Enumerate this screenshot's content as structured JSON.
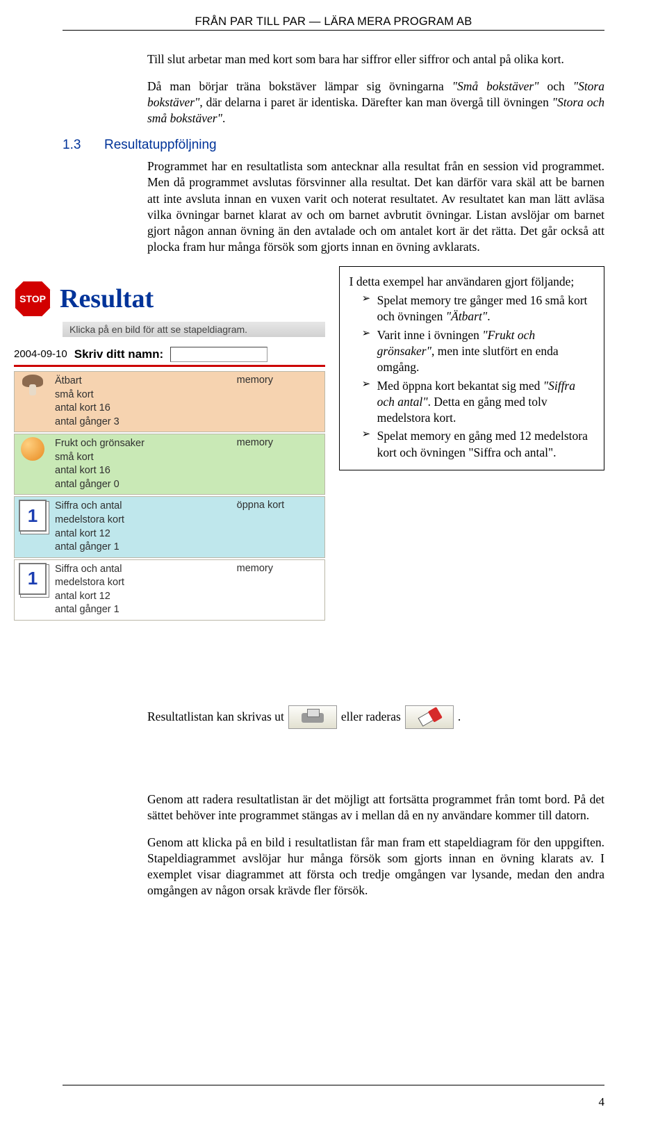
{
  "header": "FRÅN PAR TILL PAR — LÄRA MERA PROGRAM AB",
  "intro1": "Till slut arbetar man med kort som bara har siffror eller siffror och antal på olika kort.",
  "intro2_a": "Då man börjar träna bokstäver lämpar sig övningarna ",
  "intro2_i1": "\"Små bokstäver\"",
  "intro2_b": " och ",
  "intro2_i2": "\"Stora bokstäver\"",
  "intro2_c": ", där delarna i paret är identiska. Därefter kan man övergå till övningen ",
  "intro2_i3": "\"Stora och små bokstäver\"",
  "intro2_d": ".",
  "section": {
    "num": "1.3",
    "title": "Resultatuppföljning"
  },
  "body1": "Programmet har en resultatlista som antecknar alla resultat från en session vid programmet. Men då programmet avslutas försvinner alla resultat. Det kan därför vara skäl att be barnen att inte avsluta innan en vuxen varit och noterat resultatet. Av resultatet kan man lätt avläsa vilka övningar barnet klarat av och om barnet avbrutit övningar. Listan avslöjar om barnet gjort någon annan övning än den avtalade och om antalet kort är det rätta. Det går också att plocka fram hur många försök som gjorts innan en övning avklarats.",
  "shot": {
    "stop": "STOP",
    "title": "Resultat",
    "sub": "Klicka på en bild för att se stapeldiagram.",
    "date": "2004-09-10",
    "nameLabel": "Skriv ditt namn:",
    "rows": [
      {
        "bg": "bg-peach",
        "thumb": "mushroom",
        "t1": "Ätbart",
        "t2": "små kort",
        "t3": "antal kort 16",
        "t4": "antal gånger 3",
        "mode": "memory"
      },
      {
        "bg": "bg-green",
        "thumb": "orange",
        "t1": "Frukt och grönsaker",
        "t2": "små kort",
        "t3": "antal kort 16",
        "t4": "antal gånger 0",
        "mode": "memory"
      },
      {
        "bg": "bg-cyan",
        "thumb": "digit1",
        "t1": "Siffra och antal",
        "t2": "medelstora kort",
        "t3": "antal kort 12",
        "t4": "antal gånger 1",
        "mode": "öppna kort"
      },
      {
        "bg": "bg-white",
        "thumb": "digit1",
        "t1": "Siffra och antal",
        "t2": "medelstora kort",
        "t3": "antal kort 12",
        "t4": "antal gånger 1",
        "mode": "memory"
      }
    ]
  },
  "example": {
    "lead": "I detta exempel har användaren gjort följande;",
    "b1a": "Spelat memory tre gånger med 16 små kort och övningen ",
    "b1i": "\"Ätbart\"",
    "b1b": ".",
    "b2a": "Varit inne i övningen ",
    "b2i": "\"Frukt och grönsaker\"",
    "b2b": ", men inte slutfört en enda omgång.",
    "b3a": "Med öppna kort bekantat sig med ",
    "b3i": "\"Siffra och antal\"",
    "b3b": ". Detta en gång med tolv medelstora kort.",
    "b4": "Spelat memory en gång med 12 medelstora kort och övningen \"Siffra och antal\"."
  },
  "util": {
    "a": "Resultatlistan kan skrivas ut",
    "b": "eller raderas",
    "c": "."
  },
  "tail1": "Genom att radera resultatlistan är det möjligt att fortsätta programmet från tomt bord. På det sättet behöver inte programmet stängas av i mellan då en ny användare kommer till datorn.",
  "tail2": "Genom att klicka på en bild i resultatlistan får man fram ett stapeldiagram för den uppgiften. Stapeldiagrammet avslöjar hur många försök som gjorts innan en övning klarats av. I exemplet visar diagrammet att första och tredje omgången var lysande, medan den andra omgången av någon orsak krävde fler försök.",
  "pageNum": "4"
}
